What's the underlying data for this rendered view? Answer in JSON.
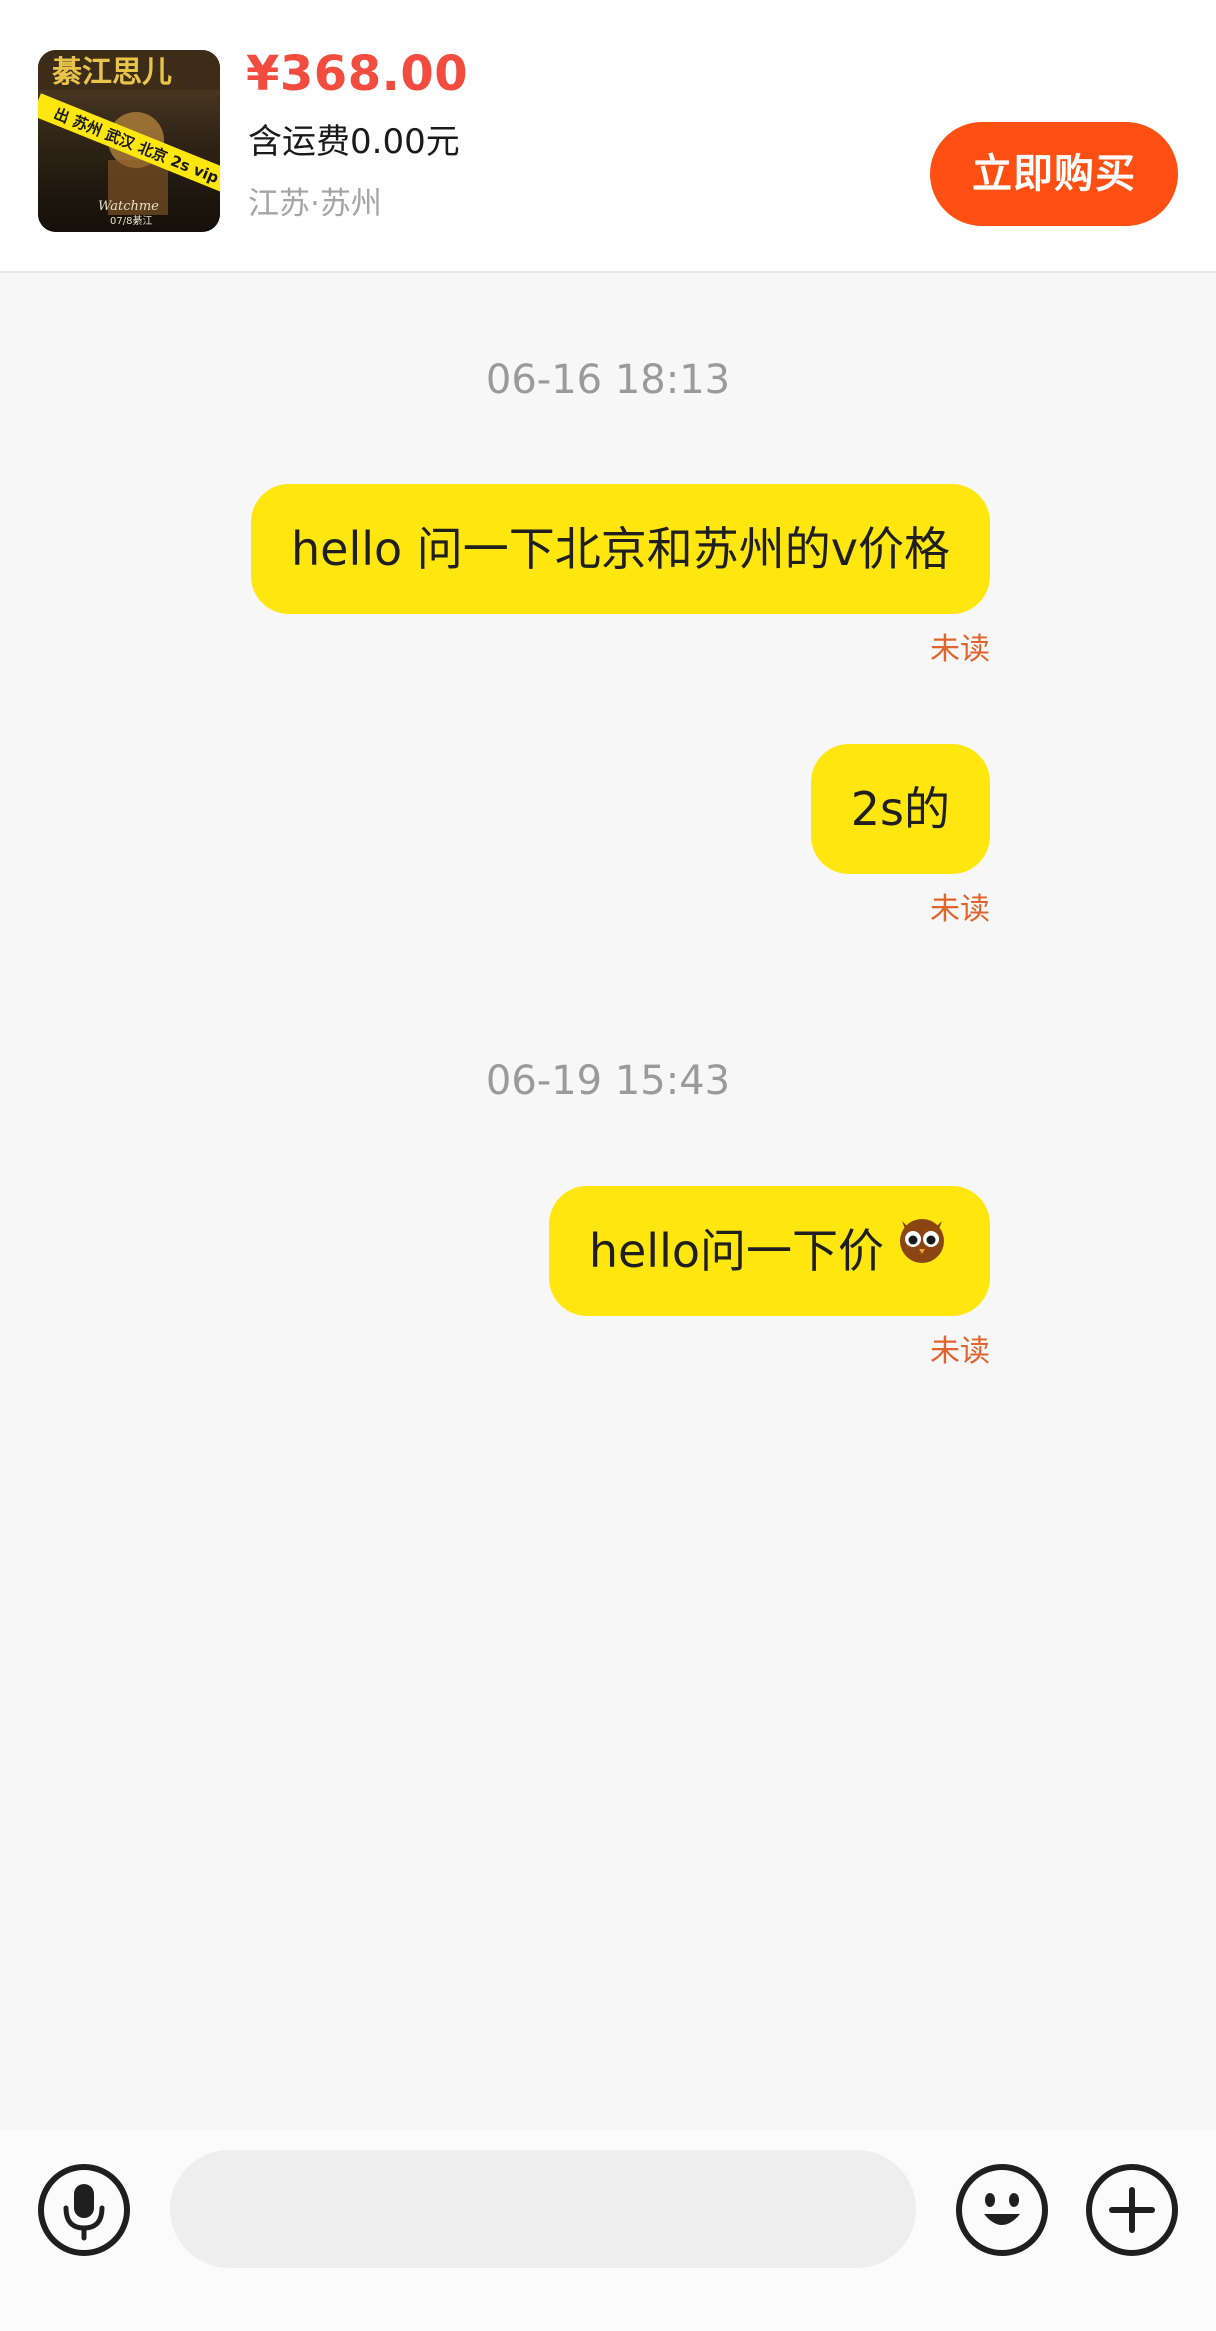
{
  "product": {
    "price": "¥368.00",
    "shipping": "含运费0.00元",
    "location": "江苏·苏州",
    "buy_label": "立即购买",
    "thumbnail_banner": "出 苏州 武汉 北京 2s vip",
    "thumbnail_title": "綦江思儿"
  },
  "chat": {
    "groups": [
      {
        "time": "06-16 18:13",
        "messages": [
          {
            "text": "hello 问一下北京和苏州的v价格",
            "status": "未读"
          },
          {
            "text": "2s的",
            "status": "未读"
          }
        ]
      },
      {
        "time": "06-19 15:43",
        "messages": [
          {
            "text": "hello问一下价",
            "status": "未读",
            "emoji": "owl-emoji"
          }
        ]
      }
    ]
  },
  "input_bar": {
    "voice_icon": "microphone-icon",
    "placeholder": "",
    "emoji_icon": "smiley-icon",
    "more_icon": "plus-icon"
  },
  "colors": {
    "price": "#f14c3e",
    "buy_button": "#ff4f12",
    "bubble": "#ffe60f",
    "unread": "#e0642c"
  }
}
